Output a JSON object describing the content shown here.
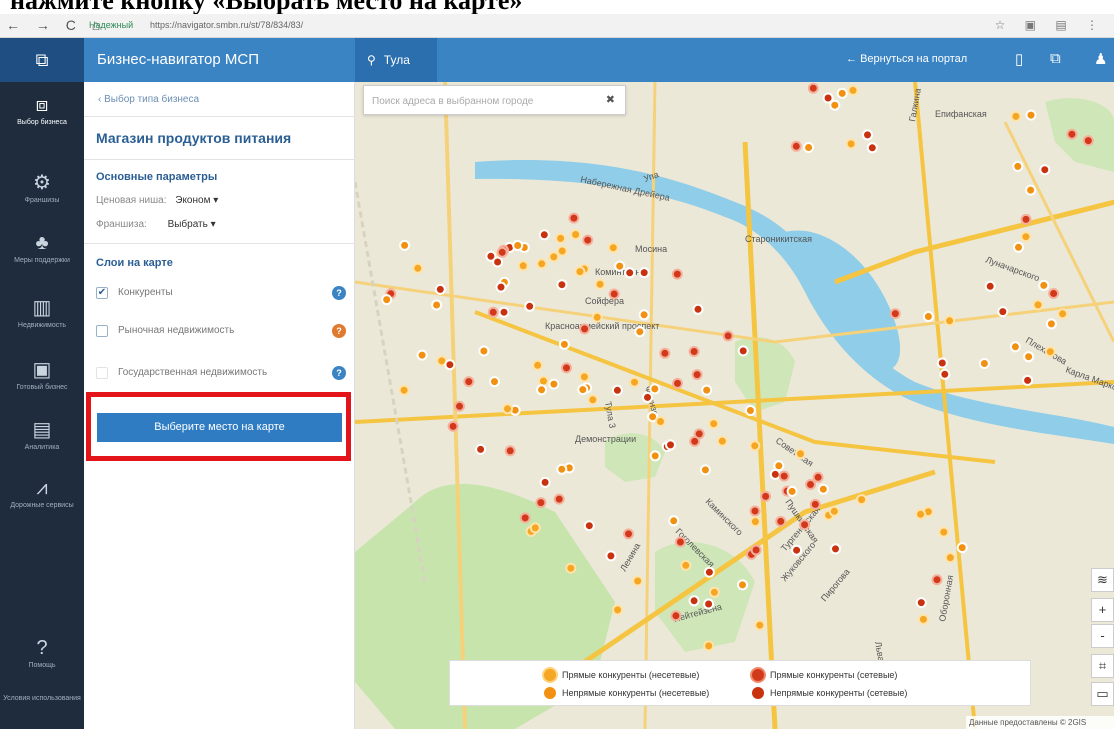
{
  "caption": "нажмите кнопку «Выбрать место на карте»",
  "browser": {
    "secure_label": "Надежный",
    "url": "https://navigator.smbn.ru/st/78/834/83/"
  },
  "header": {
    "brand": "Бизнес-навигатор МСП",
    "city": "Тула",
    "back_label": "Вернуться на портал"
  },
  "sidebar": {
    "items": [
      {
        "label": "Выбор бизнеса",
        "icon": "briefcase-icon",
        "active": true
      },
      {
        "label": "Франшизы",
        "icon": "franchise-icon",
        "active": false
      },
      {
        "label": "Меры поддержки",
        "icon": "people-icon",
        "active": false
      },
      {
        "label": "Недвижимость",
        "icon": "building-icon",
        "active": false
      },
      {
        "label": "Готовый бизнес",
        "icon": "store-icon",
        "active": false
      },
      {
        "label": "Аналитика",
        "icon": "analytics-icon",
        "active": false
      },
      {
        "label": "Дорожные сервисы",
        "icon": "road-icon",
        "active": false
      }
    ],
    "help_label": "Помощь",
    "terms_label": "Условия использования"
  },
  "panel": {
    "breadcrumb": "‹ Выбор типа бизнеса",
    "title": "Магазин продуктов питания",
    "params_heading": "Основные параметры",
    "price_label": "Ценовая ниша:",
    "price_value": "Эконом ▾",
    "franchise_label": "Франшиза:",
    "franchise_value": "Выбрать ▾",
    "layers_heading": "Слои на карте",
    "layers": [
      {
        "label": "Конкуренты",
        "checked": true,
        "help_color": "#3a84c4"
      },
      {
        "label": "Рыночная недвижимость",
        "checked": false,
        "help_color": "#e07a2e"
      },
      {
        "label": "Государственная недвижимость",
        "checked": false,
        "help_color": "#3a84c4"
      }
    ],
    "select_button": "Выберите место на карте"
  },
  "map": {
    "search_placeholder": "Поиск адреса в выбранном городе",
    "labels": [
      "Набережная Дрейера",
      "Мосина",
      "Коминтерна",
      "Сойфера",
      "Красноармейский проспект",
      "Демонстрации",
      "Пушкинская",
      "Советская",
      "Каминского",
      "Гоголевская",
      "Тургеневская",
      "Жуковского",
      "Пирогова",
      "Лейтейзена",
      "Льва Толстого",
      "Оборонная",
      "Староникитская",
      "Упа",
      "Галкина",
      "Луначарского",
      "Плеханова",
      "Карла Маркса",
      "Епифанская",
      "Тула 3",
      "Фрунзе",
      "Ленина",
      "Бундурина"
    ],
    "legend": [
      {
        "label": "Прямые конкуренты (несетевые)",
        "color": "#f5a623",
        "ring": "#ffd27a"
      },
      {
        "label": "Прямые конкуренты (сетевые)",
        "color": "#d2391b",
        "ring": "#f08a6e"
      },
      {
        "label": "Непрямые конкуренты (несетевые)",
        "color": "#f29111",
        "ring": ""
      },
      {
        "label": "Непрямые конкуренты (сетевые)",
        "color": "#c8320f",
        "ring": ""
      }
    ],
    "attribution": "Данные предоставлены © 2GIS"
  }
}
